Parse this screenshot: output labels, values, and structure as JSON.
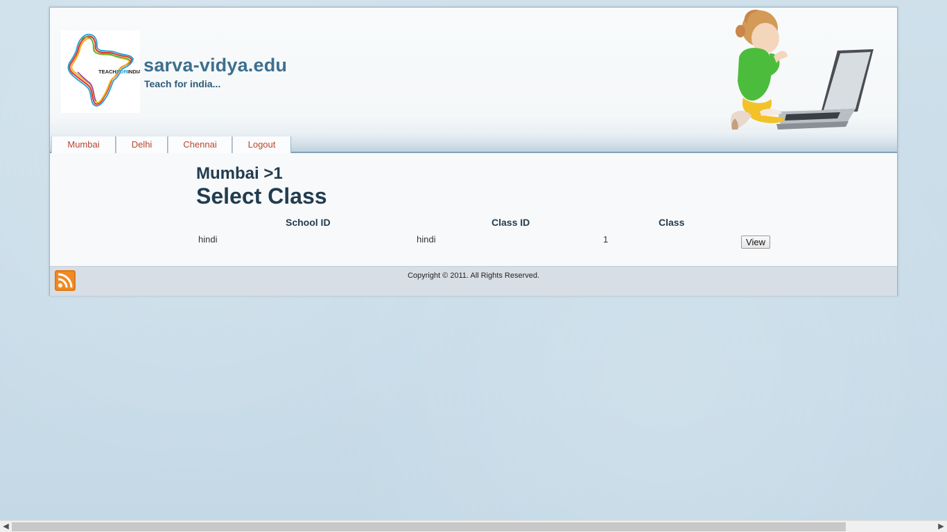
{
  "header": {
    "site_title": "sarva-vidya.edu",
    "tagline": "Teach for india...",
    "logo_text_left": "TEACH",
    "logo_text_mid": "FOR",
    "logo_text_right": "INDIA"
  },
  "nav": {
    "tabs": [
      {
        "label": "Mumbai"
      },
      {
        "label": "Delhi"
      },
      {
        "label": "Chennai"
      },
      {
        "label": "Logout"
      }
    ]
  },
  "main": {
    "breadcrumb": "Mumbai >1",
    "heading": "Select Class",
    "table": {
      "headers": [
        "School ID",
        "Class ID",
        "Class"
      ],
      "rows": [
        {
          "school_id": "hindi",
          "class_id": "hindi",
          "class": "1",
          "action": "View"
        }
      ]
    }
  },
  "footer": {
    "copyright": "Copyright © 2011. All Rights Reserved."
  },
  "icons": {
    "rss": "rss-icon",
    "scroll_left": "chevron-left-icon",
    "scroll_right": "chevron-right-icon"
  },
  "colors": {
    "accent": "#3d6f8e",
    "nav_link": "#b8452b",
    "heading": "#223c4f",
    "rss": "#f08a24"
  }
}
